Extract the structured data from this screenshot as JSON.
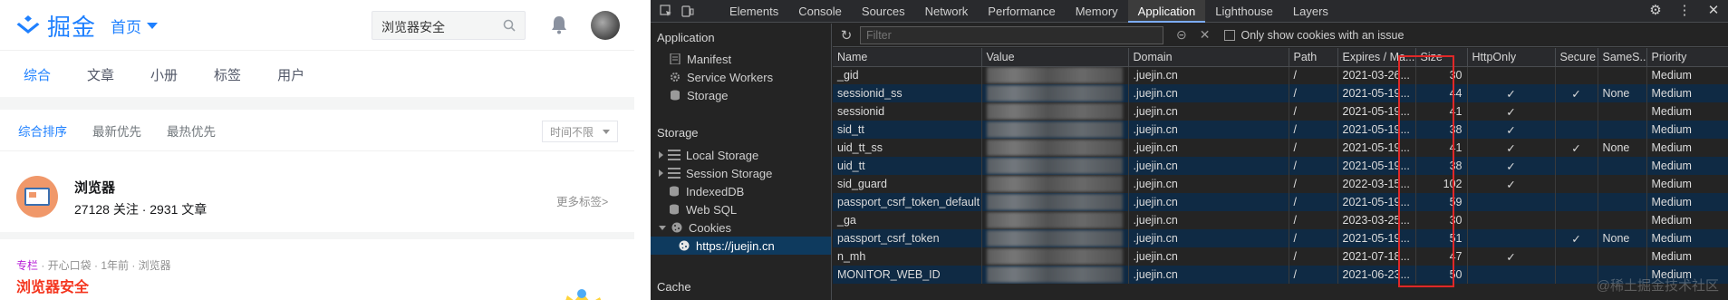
{
  "site": {
    "logo_text": "掘金",
    "home_label": "首页",
    "search_value": "浏览器安全",
    "nav_tabs": [
      "综合",
      "文章",
      "小册",
      "标签",
      "用户"
    ],
    "sort_tabs": [
      "综合排序",
      "最新优先",
      "最热优先"
    ],
    "time_filter": "时间不限",
    "tag": {
      "name": "浏览器",
      "stats": "27128 关注 · 2931 文章",
      "more": "更多标签>"
    },
    "entry": {
      "column": "专栏",
      "meta": " · 开心口袋 · 1年前 · 浏览器",
      "title": "浏览器安全"
    }
  },
  "devtools": {
    "tabs": [
      "Elements",
      "Console",
      "Sources",
      "Network",
      "Performance",
      "Memory",
      "Application",
      "Lighthouse",
      "Layers"
    ],
    "active_tab": "Application",
    "sidebar": {
      "application_title": "Application",
      "application_items": [
        "Manifest",
        "Service Workers",
        "Storage"
      ],
      "storage_title": "Storage",
      "storage_items": [
        "Local Storage",
        "Session Storage",
        "IndexedDB",
        "Web SQL",
        "Cookies"
      ],
      "cookie_origin": "https://juejin.cn",
      "cache_title": "Cache"
    },
    "filter_placeholder": "Filter",
    "issue_checkbox_label": "Only show cookies with an issue",
    "columns": [
      "Name",
      "Value",
      "Domain",
      "Path",
      "Expires / Ma...",
      "Size",
      "HttpOnly",
      "Secure",
      "SameS...",
      "Priority"
    ],
    "cookies": [
      {
        "name": "_gid",
        "domain": ".juejin.cn",
        "path": "/",
        "expires": "2021-03-26...",
        "size": "30",
        "httponly": "",
        "secure": "",
        "samesite": "",
        "priority": "Medium"
      },
      {
        "name": "sessionid_ss",
        "domain": ".juejin.cn",
        "path": "/",
        "expires": "2021-05-19...",
        "size": "44",
        "httponly": "✓",
        "secure": "✓",
        "samesite": "None",
        "priority": "Medium"
      },
      {
        "name": "sessionid",
        "domain": ".juejin.cn",
        "path": "/",
        "expires": "2021-05-19...",
        "size": "41",
        "httponly": "✓",
        "secure": "",
        "samesite": "",
        "priority": "Medium"
      },
      {
        "name": "sid_tt",
        "domain": ".juejin.cn",
        "path": "/",
        "expires": "2021-05-19...",
        "size": "38",
        "httponly": "✓",
        "secure": "",
        "samesite": "",
        "priority": "Medium"
      },
      {
        "name": "uid_tt_ss",
        "domain": ".juejin.cn",
        "path": "/",
        "expires": "2021-05-19...",
        "size": "41",
        "httponly": "✓",
        "secure": "✓",
        "samesite": "None",
        "priority": "Medium"
      },
      {
        "name": "uid_tt",
        "domain": ".juejin.cn",
        "path": "/",
        "expires": "2021-05-19...",
        "size": "38",
        "httponly": "✓",
        "secure": "",
        "samesite": "",
        "priority": "Medium"
      },
      {
        "name": "sid_guard",
        "domain": ".juejin.cn",
        "path": "/",
        "expires": "2022-03-15...",
        "size": "102",
        "httponly": "✓",
        "secure": "",
        "samesite": "",
        "priority": "Medium"
      },
      {
        "name": "passport_csrf_token_default",
        "domain": ".juejin.cn",
        "path": "/",
        "expires": "2021-05-19...",
        "size": "59",
        "httponly": "",
        "secure": "",
        "samesite": "",
        "priority": "Medium"
      },
      {
        "name": "_ga",
        "domain": ".juejin.cn",
        "path": "/",
        "expires": "2023-03-25...",
        "size": "30",
        "httponly": "",
        "secure": "",
        "samesite": "",
        "priority": "Medium"
      },
      {
        "name": "passport_csrf_token",
        "domain": ".juejin.cn",
        "path": "/",
        "expires": "2021-05-19...",
        "size": "51",
        "httponly": "",
        "secure": "✓",
        "samesite": "None",
        "priority": "Medium"
      },
      {
        "name": "n_mh",
        "domain": ".juejin.cn",
        "path": "/",
        "expires": "2021-07-18...",
        "size": "47",
        "httponly": "✓",
        "secure": "",
        "samesite": "",
        "priority": "Medium"
      },
      {
        "name": "MONITOR_WEB_ID",
        "domain": ".juejin.cn",
        "path": "/",
        "expires": "2021-06-23...",
        "size": "50",
        "httponly": "",
        "secure": "",
        "samesite": "",
        "priority": "Medium"
      }
    ],
    "watermark": "@稀土掘金技术社区"
  },
  "colors": {
    "brand": "#1e80ff",
    "entry_title": "#f4351e",
    "highlight": "#e02828"
  }
}
